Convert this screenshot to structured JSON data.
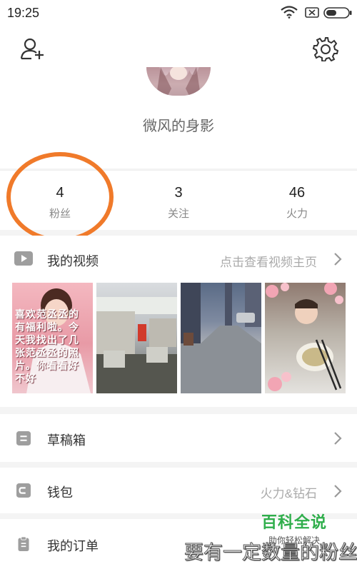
{
  "status_bar": {
    "time": "19:25"
  },
  "profile": {
    "name": "微风的身影"
  },
  "stats": [
    {
      "value": "4",
      "label": "粉丝"
    },
    {
      "value": "3",
      "label": "关注"
    },
    {
      "value": "46",
      "label": "火力"
    }
  ],
  "my_videos": {
    "title": "我的视频",
    "link_text": "点击查看视频主页",
    "thumb_1_caption": "喜欢范丞丞的有福利啦。今天我找出了几张范丞丞的照片。你看看好不好"
  },
  "drafts": {
    "title": "草稿箱"
  },
  "wallet": {
    "title": "钱包",
    "subtitle": "火力&钻石"
  },
  "orders": {
    "title": "我的订单"
  },
  "watermark": {
    "title": "百科全说",
    "subtitle": "助你轻松解决"
  },
  "caption": "要有一定数量的粉丝",
  "colors": {
    "highlight": "#f07a2a",
    "watermark": "#2fae4b",
    "icon_gray": "#9e9e9e"
  },
  "icons": [
    "wifi-icon",
    "close-box-icon",
    "battery-icon",
    "add-friend-icon",
    "settings-icon",
    "video-icon",
    "drafts-icon",
    "wallet-icon",
    "orders-icon",
    "chevron-right-icon"
  ]
}
